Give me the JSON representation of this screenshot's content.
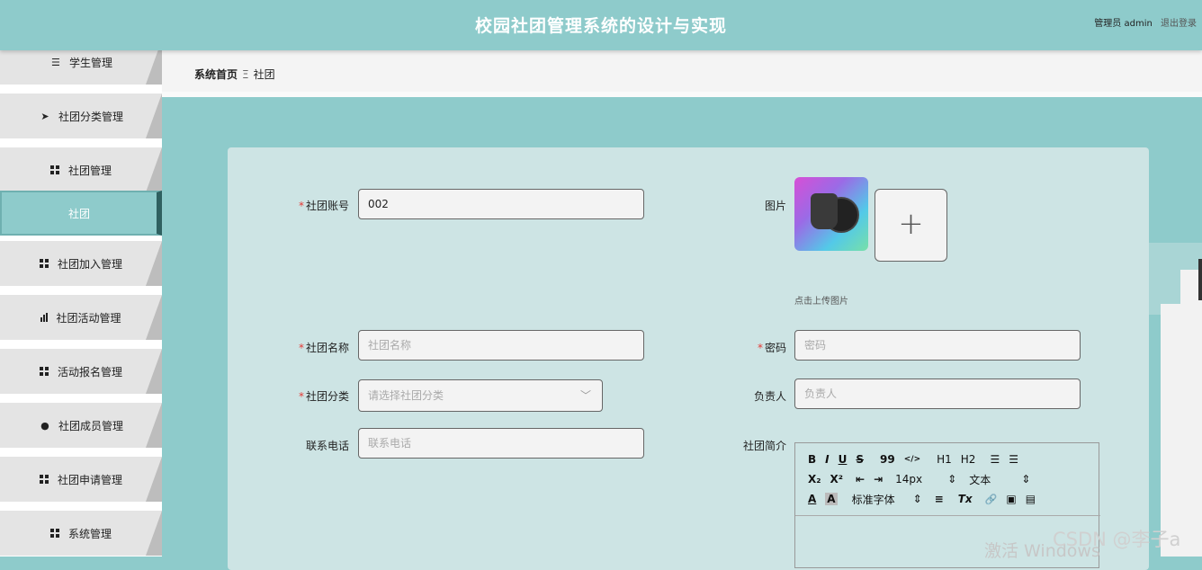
{
  "header": {
    "title": "校园社团管理系统的设计与实现",
    "user_label": "管理员 admin",
    "logout_label": "退出登录"
  },
  "sidebar": {
    "items": [
      {
        "label": "学生管理",
        "icon": "sliders-icon"
      },
      {
        "label": "社团分类管理",
        "icon": "send-icon"
      },
      {
        "label": "社团管理",
        "icon": "grid-icon"
      },
      {
        "label": "社团",
        "icon": "",
        "active": true
      },
      {
        "label": "社团加入管理",
        "icon": "grid-icon"
      },
      {
        "label": "社团活动管理",
        "icon": "bar-chart-icon"
      },
      {
        "label": "活动报名管理",
        "icon": "grid-icon"
      },
      {
        "label": "社团成员管理",
        "icon": "pin-icon"
      },
      {
        "label": "社团申请管理",
        "icon": "grid-icon"
      },
      {
        "label": "系统管理",
        "icon": "grid-icon"
      }
    ]
  },
  "breadcrumb": {
    "home": "系统首页",
    "separator": "Ξ",
    "current": "社团"
  },
  "form": {
    "account": {
      "label": "社团账号",
      "value": "002",
      "required": true
    },
    "image": {
      "label": "图片",
      "upload_hint": "点击上传图片",
      "add_symbol": "+"
    },
    "name": {
      "label": "社团名称",
      "placeholder": "社团名称",
      "required": true
    },
    "password": {
      "label": "密码",
      "placeholder": "密码",
      "required": true
    },
    "category": {
      "label": "社团分类",
      "placeholder": "请选择社团分类",
      "required": true
    },
    "leader": {
      "label": "负责人",
      "placeholder": "负责人"
    },
    "phone": {
      "label": "联系电话",
      "placeholder": "联系电话"
    },
    "intro": {
      "label": "社团简介",
      "toolbar_row1": [
        "B",
        "I",
        "U",
        "S",
        "99",
        "</>",
        "H1",
        "H2",
        "☰",
        "☰"
      ],
      "toolbar_row2": [
        "X₂",
        "X²",
        "⇤",
        "⇥",
        "14px",
        "⇕",
        "文本",
        "⇕"
      ],
      "toolbar_row3": [
        "A",
        "A",
        "标准字体",
        "⇕",
        "≡",
        "Tx",
        "🔗",
        "▣",
        "▤"
      ]
    }
  },
  "overlay": {
    "windows_watermark": "激活 Windows",
    "csdn_watermark": "CSDN @李子a"
  },
  "colors": {
    "theme": "#8ecbcb",
    "card": "#cde4e4",
    "required": "#e53935"
  }
}
